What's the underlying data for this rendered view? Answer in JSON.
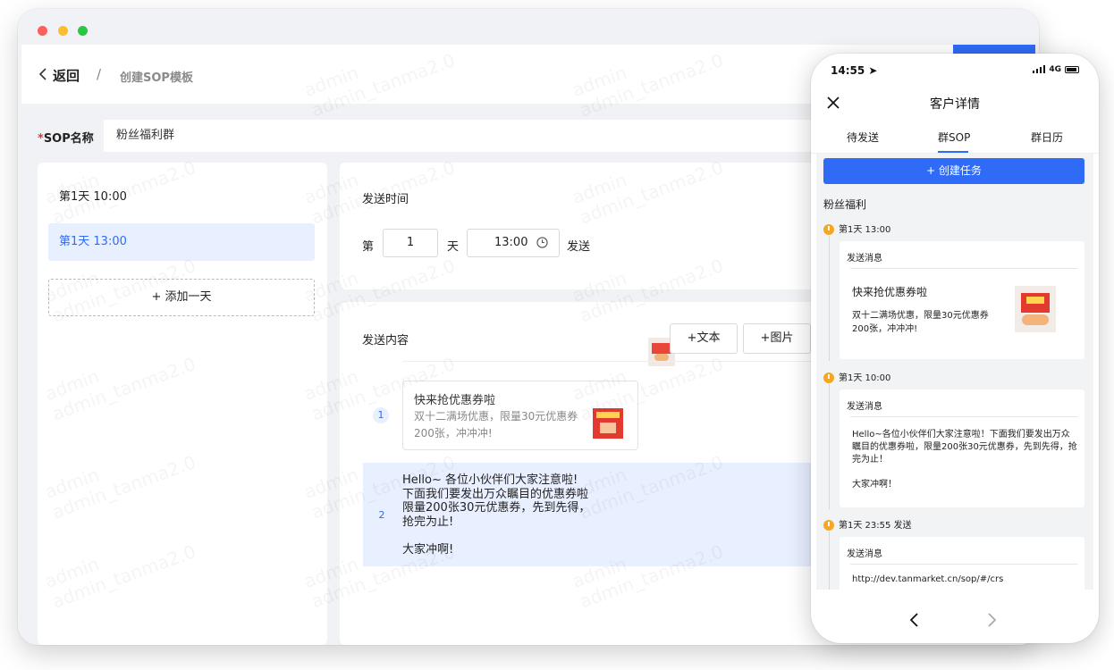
{
  "watermark": {
    "line1": "admin",
    "line2": "admin_tanma2.0"
  },
  "header": {
    "back_label": "返回",
    "separator": "/",
    "page_title": "创建SOP模板"
  },
  "sop_name": {
    "required_mark": "*",
    "label": "SOP名称",
    "value": "粉丝福利群"
  },
  "days": [
    {
      "label": "第1天 10:00",
      "active": false
    },
    {
      "label": "第1天 13:00",
      "active": true
    }
  ],
  "add_day_label": "+ 添加一天",
  "send_time": {
    "title": "发送时间",
    "prefix": "第",
    "day_value": "1",
    "day_unit": "天",
    "time_value": "13:00",
    "suffix": "发送"
  },
  "send_content": {
    "title": "发送内容",
    "add_text_label": "+文本",
    "add_image_label": "+图片",
    "messages": [
      {
        "index": "1",
        "title": "快来抢优惠券啦",
        "desc": "双十二满场优惠，限量30元优惠券200张，冲冲冲!"
      },
      {
        "index": "2",
        "text": "Hello~ 各位小伙伴们大家注意啦!\n下面我们要发出万众瞩目的优惠券啦\n限量200张30元优惠券，先到先得，\n抢完为止!\n\n大家冲啊!"
      }
    ]
  },
  "phone": {
    "time": "14:55",
    "network": "4G",
    "title": "客户详情",
    "tabs": [
      "待发送",
      "群SOP",
      "群日历"
    ],
    "active_tab": 1,
    "create_task_label": "+ 创建任务",
    "group_name": "粉丝福利",
    "timeline": [
      {
        "time": "第1天 13:00",
        "card_header": "发送消息",
        "title": "快来抢优惠券啦",
        "desc": "双十二满场优惠，限量30元优惠券200张，冲冲冲!"
      },
      {
        "time": "第1天 10:00",
        "card_header": "发送消息",
        "text": "Hello~各位小伙伴们大家注意啦！下面我们要发出万众瞩目的优惠券啦，限量200张30元优惠券，先到先得，抢完为止！\n\n大家冲啊！"
      },
      {
        "time": "第1天 23:55 发送",
        "card_header": "发送消息",
        "url": "http://dev.tanmarket.cn/sop/#/crs"
      }
    ]
  },
  "colors": {
    "accent": "#2f6bf6",
    "timeline_dot": "#f5a623",
    "required": "#e53935"
  }
}
